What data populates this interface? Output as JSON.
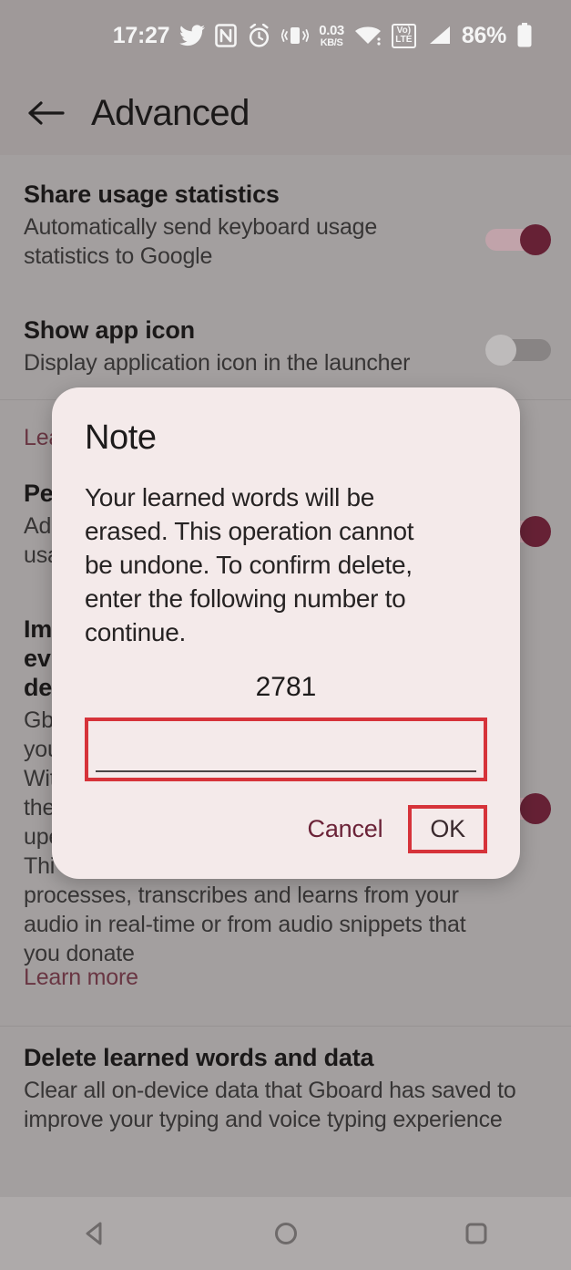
{
  "status_bar": {
    "time": "17:27",
    "icons": [
      {
        "name": "twitter-icon",
        "label": "twitter"
      },
      {
        "name": "nfc-icon",
        "label": "N"
      },
      {
        "name": "alarm-icon",
        "label": "alarm"
      },
      {
        "name": "vibrate-icon",
        "label": "vibrate"
      }
    ],
    "data_rate_value": "0.03",
    "data_rate_unit": "KB/S",
    "wifi_label": "wifi",
    "volte_line1": "Vo)",
    "volte_line2": "LTE",
    "signal_label": "signal",
    "battery_percent": "86%",
    "battery_label": "battery"
  },
  "app_bar": {
    "back_label": "Back",
    "title": "Advanced"
  },
  "settings": [
    {
      "id": "share-usage-statistics",
      "title": "Share usage statistics",
      "subtitle": "Automatically send keyboard usage statistics to Google",
      "toggle": "on"
    },
    {
      "id": "show-app-icon",
      "title": "Show app icon",
      "subtitle": "Display application icon in the launcher",
      "toggle": "off"
    }
  ],
  "obscured": {
    "learn_more_top": "Lea",
    "personalize_title": "Pe",
    "personalize_sub_line1": "Ad",
    "personalize_sub_line2": "usa",
    "improve_title_line1": "Im",
    "improve_title_line2": "ev",
    "improve_title_line3": "de",
    "improve_sub_line1": "Gb",
    "improve_sub_line2": "you",
    "improve_sub_line3": "Wit",
    "improve_sub_line4": "the",
    "improve_sub_line5": "upe",
    "improve_sub_line6": "Thi",
    "improve_sub_line7": "processes, transcribes and learns from your",
    "improve_sub_line8": "audio in real-time or from audio snippets that",
    "improve_sub_line9": "you donate",
    "learn_more_bottom": "Learn more",
    "toggle_mid": "on",
    "toggle_low": "on"
  },
  "delete_setting": {
    "title": "Delete learned words and data",
    "subtitle_line1": "Clear all on-device data that Gboard has saved to",
    "subtitle_line2": "improve your typing and voice typing experience"
  },
  "dialog": {
    "title": "Note",
    "message_line1": "Your learned words will be",
    "message_line2": "erased. This operation cannot",
    "message_line3": "be undone. To confirm delete,",
    "message_line4": "enter the following number to",
    "message_line5": "continue.",
    "number": "2781",
    "input_value": "",
    "input_placeholder": "",
    "cancel_label": "Cancel",
    "ok_label": "OK"
  },
  "nav_bar": {
    "back": "back-triangle",
    "home": "home-circle",
    "recents": "recents-square"
  },
  "colors": {
    "accent": "#6b2338",
    "annotation": "#d6333a",
    "dialog_bg": "#f4eaea",
    "screen_bg": "#aaa6a6"
  }
}
